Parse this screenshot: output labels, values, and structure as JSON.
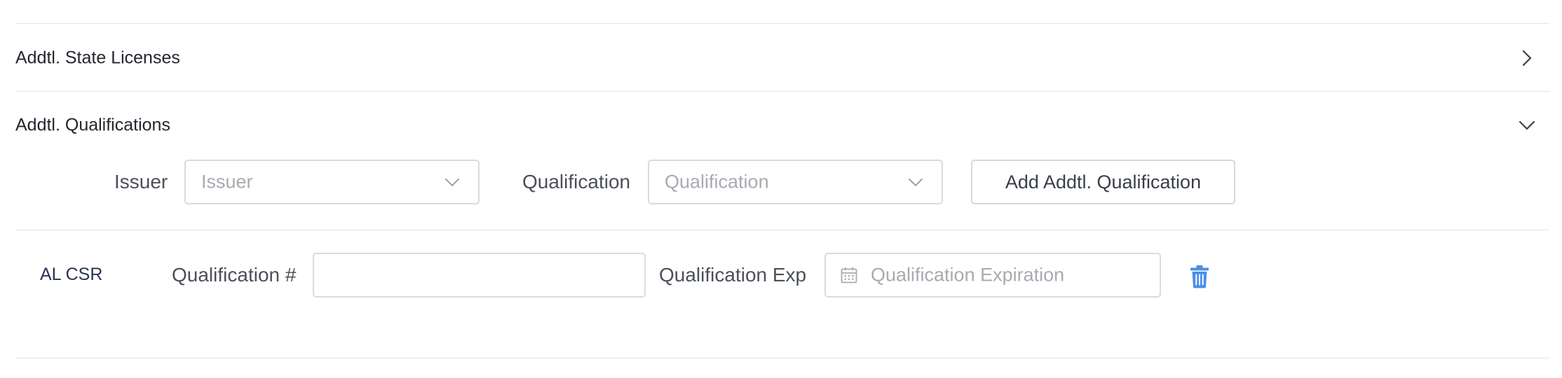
{
  "sections": {
    "state_licenses": {
      "title": "Addtl. State Licenses",
      "expanded": false,
      "chevron_icon": "chevron-right-icon"
    },
    "qualifications": {
      "title": "Addtl. Qualifications",
      "expanded": true,
      "chevron_icon": "chevron-down-icon"
    }
  },
  "add_form": {
    "issuer_label": "Issuer",
    "issuer_placeholder": "Issuer",
    "qualification_label": "Qualification",
    "qualification_placeholder": "Qualification",
    "add_button_label": "Add Addtl. Qualification"
  },
  "qualification_rows": [
    {
      "code": "AL CSR",
      "number_label": "Qualification #",
      "number_value": "",
      "exp_label": "Qualification Exp",
      "exp_placeholder": "Qualification Expiration",
      "delete_icon": "trash-icon"
    }
  ],
  "colors": {
    "accent": "#4a8fe7",
    "border": "#d9dbde",
    "divider": "#e3e5e8",
    "placeholder": "#a7abb1"
  }
}
